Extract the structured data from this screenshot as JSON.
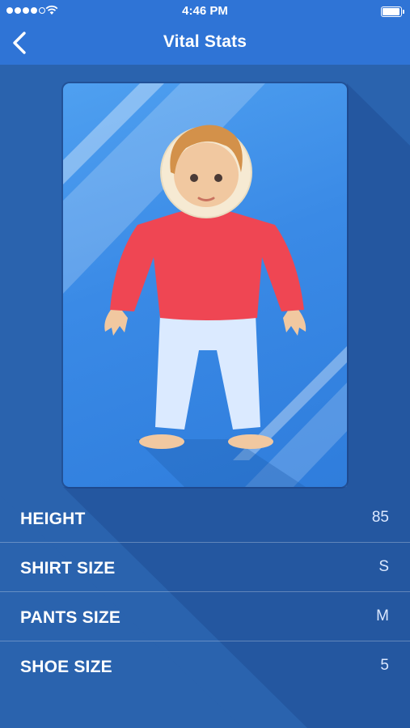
{
  "status_bar": {
    "time": "4:46 PM",
    "signal_bars": 5,
    "signal_filled": 4
  },
  "nav": {
    "title": "Vital Stats",
    "back_icon": "chevron-left-icon"
  },
  "avatar": {
    "shirt_color": "#ef4653",
    "pants_color": "#dbeaff",
    "skin_color": "#f1c8a0"
  },
  "stats": [
    {
      "label": "HEIGHT",
      "value": "85"
    },
    {
      "label": "SHIRT SIZE",
      "value": "S"
    },
    {
      "label": "PANTS SIZE",
      "value": "M"
    },
    {
      "label": "SHOE SIZE",
      "value": "5"
    }
  ],
  "colors": {
    "background": "#2a63ae",
    "nav": "#2f74d6",
    "card": "#3a8ae6"
  }
}
